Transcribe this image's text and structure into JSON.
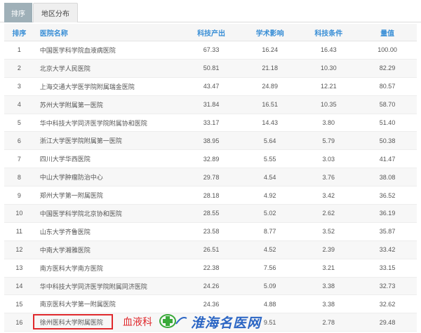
{
  "tabs": {
    "rank": "排序",
    "region": "地区分布"
  },
  "headers": {
    "rank": "排序",
    "name": "医院名称",
    "output": "科技产出",
    "influence": "学术影响",
    "conditions": "科技条件",
    "score": "量值"
  },
  "rows": [
    {
      "rank": "1",
      "name": "中国医学科学院血液病医院",
      "output": "67.33",
      "influence": "16.24",
      "conditions": "16.43",
      "score": "100.00"
    },
    {
      "rank": "2",
      "name": "北京大学人民医院",
      "output": "50.81",
      "influence": "21.18",
      "conditions": "10.30",
      "score": "82.29"
    },
    {
      "rank": "3",
      "name": "上海交通大学医学院附属瑞金医院",
      "output": "43.47",
      "influence": "24.89",
      "conditions": "12.21",
      "score": "80.57"
    },
    {
      "rank": "4",
      "name": "苏州大学附属第一医院",
      "output": "31.84",
      "influence": "16.51",
      "conditions": "10.35",
      "score": "58.70"
    },
    {
      "rank": "5",
      "name": "华中科技大学同济医学院附属协和医院",
      "output": "33.17",
      "influence": "14.43",
      "conditions": "3.80",
      "score": "51.40"
    },
    {
      "rank": "6",
      "name": "浙江大学医学院附属第一医院",
      "output": "38.95",
      "influence": "5.64",
      "conditions": "5.79",
      "score": "50.38"
    },
    {
      "rank": "7",
      "name": "四川大学华西医院",
      "output": "32.89",
      "influence": "5.55",
      "conditions": "3.03",
      "score": "41.47"
    },
    {
      "rank": "8",
      "name": "中山大学肿瘤防治中心",
      "output": "29.78",
      "influence": "4.54",
      "conditions": "3.76",
      "score": "38.08"
    },
    {
      "rank": "9",
      "name": "郑州大学第一附属医院",
      "output": "28.18",
      "influence": "4.92",
      "conditions": "3.42",
      "score": "36.52"
    },
    {
      "rank": "10",
      "name": "中国医学科学院北京协和医院",
      "output": "28.55",
      "influence": "5.02",
      "conditions": "2.62",
      "score": "36.19"
    },
    {
      "rank": "11",
      "name": "山东大学齐鲁医院",
      "output": "23.58",
      "influence": "8.77",
      "conditions": "3.52",
      "score": "35.87"
    },
    {
      "rank": "12",
      "name": "中南大学湘雅医院",
      "output": "26.51",
      "influence": "4.52",
      "conditions": "2.39",
      "score": "33.42"
    },
    {
      "rank": "13",
      "name": "南方医科大学南方医院",
      "output": "22.38",
      "influence": "7.56",
      "conditions": "3.21",
      "score": "33.15"
    },
    {
      "rank": "14",
      "name": "华中科技大学同济医学院附属同济医院",
      "output": "24.26",
      "influence": "5.09",
      "conditions": "3.38",
      "score": "32.73"
    },
    {
      "rank": "15",
      "name": "南京医科大学第一附属医院",
      "output": "24.36",
      "influence": "4.88",
      "conditions": "3.38",
      "score": "32.62"
    },
    {
      "rank": "16",
      "name": "徐州医科大学附属医院",
      "output": "",
      "influence": "9.51",
      "conditions": "2.78",
      "score": "29.48"
    }
  ],
  "overlay": {
    "specialty": "血液科",
    "site": "淮海名医网"
  },
  "colors": {
    "header_text": "#3a8fd6",
    "highlight": "#e0292d",
    "logo": "#2c66c4",
    "logo_cross": "#3aaa3a"
  },
  "icons": {
    "logo": "green-cross-icon"
  }
}
